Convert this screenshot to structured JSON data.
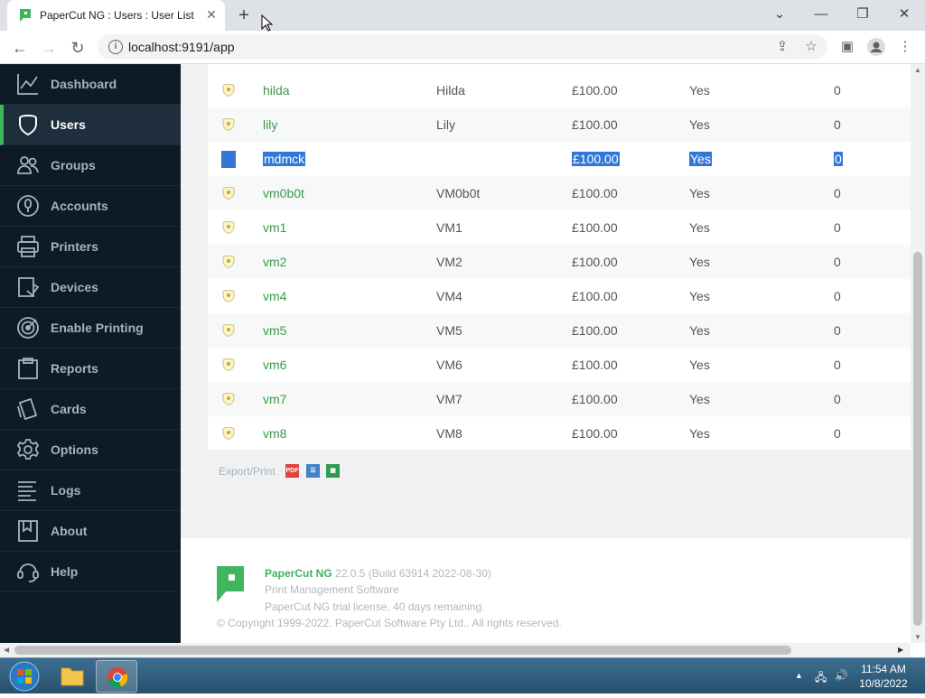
{
  "browser": {
    "tab_title": "PaperCut NG : Users : User List",
    "url": "localhost:9191/app",
    "new_tab": "+",
    "tab_close": "✕",
    "minimize": "—",
    "restore": "❐",
    "close": "✕"
  },
  "sidebar": {
    "items": [
      {
        "label": "Dashboard",
        "icon": "chart-icon"
      },
      {
        "label": "Users",
        "icon": "user-icon",
        "active": true
      },
      {
        "label": "Groups",
        "icon": "groups-icon"
      },
      {
        "label": "Accounts",
        "icon": "accounts-icon"
      },
      {
        "label": "Printers",
        "icon": "printer-icon"
      },
      {
        "label": "Devices",
        "icon": "device-icon"
      },
      {
        "label": "Enable Printing",
        "icon": "enable-printing-icon"
      },
      {
        "label": "Reports",
        "icon": "reports-icon"
      },
      {
        "label": "Cards",
        "icon": "cards-icon"
      },
      {
        "label": "Options",
        "icon": "gear-icon"
      },
      {
        "label": "Logs",
        "icon": "logs-icon"
      },
      {
        "label": "About",
        "icon": "about-icon"
      },
      {
        "label": "Help",
        "icon": "help-icon"
      }
    ]
  },
  "users_table": {
    "rows": [
      {
        "username": "hilda",
        "full_name": "Hilda",
        "balance": "£100.00",
        "restricted": "Yes",
        "jobs": "0"
      },
      {
        "username": "lily",
        "full_name": "Lily",
        "balance": "£100.00",
        "restricted": "Yes",
        "jobs": "0"
      },
      {
        "username": "mdmck",
        "full_name": "",
        "balance": "£100.00",
        "restricted": "Yes",
        "jobs": "0",
        "selected": true
      },
      {
        "username": "vm0b0t",
        "full_name": "VM0b0t",
        "balance": "£100.00",
        "restricted": "Yes",
        "jobs": "0"
      },
      {
        "username": "vm1",
        "full_name": "VM1",
        "balance": "£100.00",
        "restricted": "Yes",
        "jobs": "0"
      },
      {
        "username": "vm2",
        "full_name": "VM2",
        "balance": "£100.00",
        "restricted": "Yes",
        "jobs": "0"
      },
      {
        "username": "vm4",
        "full_name": "VM4",
        "balance": "£100.00",
        "restricted": "Yes",
        "jobs": "0"
      },
      {
        "username": "vm5",
        "full_name": "VM5",
        "balance": "£100.00",
        "restricted": "Yes",
        "jobs": "0"
      },
      {
        "username": "vm6",
        "full_name": "VM6",
        "balance": "£100.00",
        "restricted": "Yes",
        "jobs": "0"
      },
      {
        "username": "vm7",
        "full_name": "VM7",
        "balance": "£100.00",
        "restricted": "Yes",
        "jobs": "0"
      },
      {
        "username": "vm8",
        "full_name": "VM8",
        "balance": "£100.00",
        "restricted": "Yes",
        "jobs": "0"
      }
    ]
  },
  "export": {
    "label": "Export/Print",
    "formats": [
      "PDF",
      "list",
      "spreadsheet"
    ],
    "pdf_text": "PDF"
  },
  "footer": {
    "product": "PaperCut NG",
    "version": "22.0.5 (Build 63914 2022-08-30)",
    "tagline": "Print Management Software",
    "license": "PaperCut NG trial license, 40 days remaining.",
    "copyright": "© Copyright 1999-2022. PaperCut Software Pty Ltd.. All rights reserved."
  },
  "taskbar": {
    "time": "11:54 AM",
    "date": "10/8/2022"
  },
  "colors": {
    "accent_green": "#3fb55c",
    "sidebar_bg": "#0d1b26",
    "selection_blue": "#3378d6",
    "link_green": "#3a9a4a"
  }
}
